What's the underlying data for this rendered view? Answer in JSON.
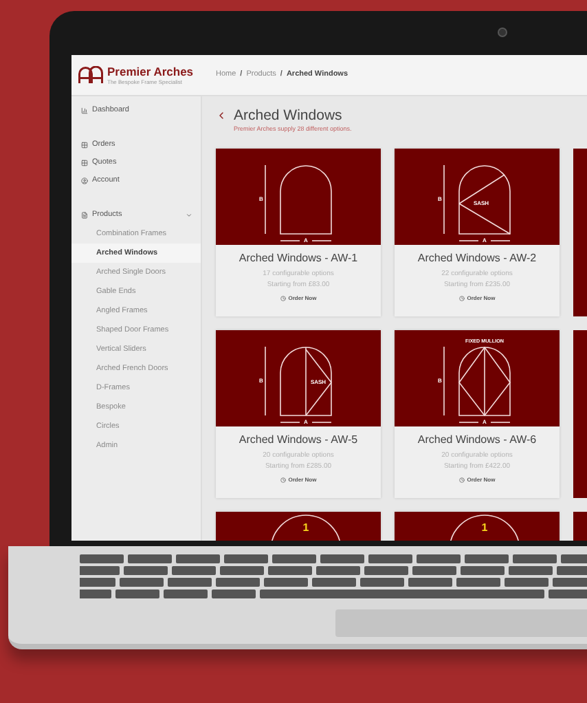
{
  "header": {
    "brand": "Premier Arches",
    "tagline": "The Bespoke Frame Specialist",
    "breadcrumb": [
      {
        "label": "Home"
      },
      {
        "separator": "/",
        "label": "Products"
      },
      {
        "separator": "/",
        "label": "Arched Windows"
      }
    ]
  },
  "sidebar": {
    "items": [
      {
        "label": "Dashboard",
        "kind": "chart"
      },
      {
        "label": "Orders",
        "kind": "grid"
      },
      {
        "label": "Quotes",
        "kind": "grid"
      },
      {
        "label": "Account",
        "kind": "user"
      },
      {
        "label": "Products",
        "kind": "doc",
        "expanded": true,
        "children": [
          {
            "label": "Combination Frames",
            "selected": false
          },
          {
            "label": "Arched Windows",
            "selected": true
          },
          {
            "label": "Arched Single Doors",
            "selected": false
          },
          {
            "label": "Gable Ends",
            "selected": false
          },
          {
            "label": "Angled Frames",
            "selected": false
          },
          {
            "label": "Shaped Door Frames",
            "selected": false
          },
          {
            "label": "Vertical Sliders",
            "selected": false
          },
          {
            "label": "Arched French Doors",
            "selected": false
          },
          {
            "label": "D-Frames",
            "selected": false
          },
          {
            "label": "Bespoke",
            "selected": false
          },
          {
            "label": "Circles",
            "selected": false
          },
          {
            "label": "Admin",
            "selected": false
          }
        ]
      }
    ]
  },
  "page": {
    "title": "Arched Windows",
    "subtitle": "Premier Arches supply 28 different options."
  },
  "product_rows": [
    [
      {
        "kind": "plain",
        "height_label": "B",
        "width_label": "A",
        "title": "Arched Windows - AW-1",
        "options": "17 configurable options",
        "price": "Starting from £83.00",
        "action": "Order Now"
      },
      {
        "kind": "sash-left",
        "height_label": "B",
        "width_label": "A",
        "sash_label": "SASH",
        "title": "Arched Windows - AW-2",
        "options": "22 configurable options",
        "price": "Starting from £235.00",
        "action": "Order Now"
      },
      {
        "kind": "stub"
      }
    ],
    [
      {
        "kind": "sash-right",
        "height_label": "B",
        "width_label": "A",
        "sash_label": "SASH",
        "title": "Arched Windows - AW-5",
        "options": "20 configurable options",
        "price": "Starting from £285.00",
        "action": "Order Now"
      },
      {
        "kind": "mullion",
        "height_label": "B",
        "width_label": "A",
        "top_label": "FIXED MULLION",
        "title": "Arched Windows - AW-6",
        "options": "20 configurable options",
        "price": "Starting from £422.00",
        "action": "Order Now"
      },
      {
        "kind": "stub"
      }
    ],
    [
      {
        "kind": "numbered",
        "number": "1"
      },
      {
        "kind": "numbered",
        "number": "1"
      },
      {
        "kind": "stub"
      }
    ]
  ]
}
